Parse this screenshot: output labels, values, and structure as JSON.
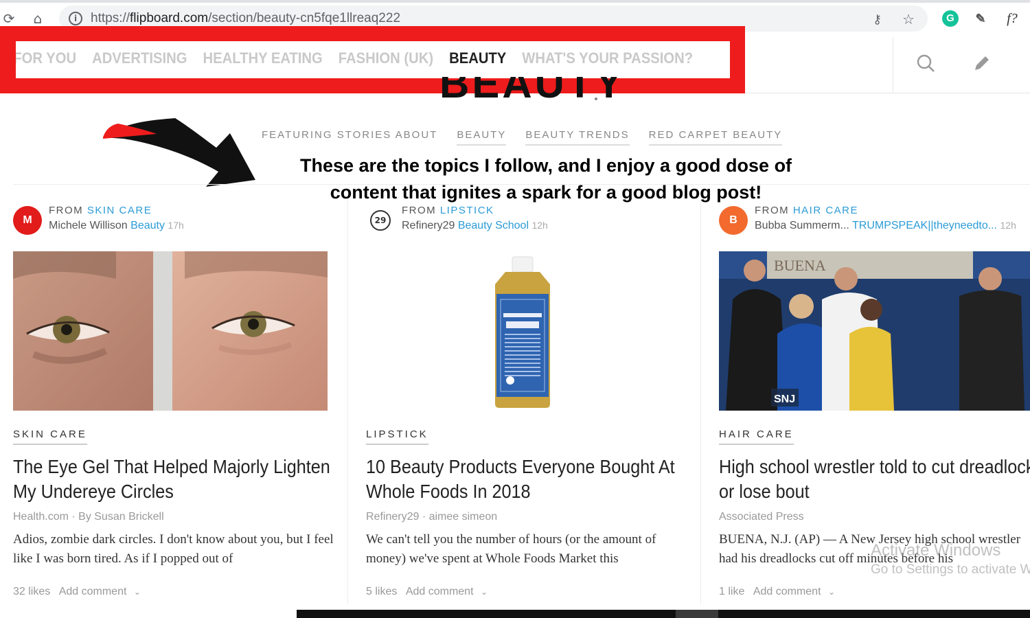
{
  "browser": {
    "url_host": "flipboard.com",
    "url_prefix": "https://",
    "url_path": "/section/beauty-cn5fqe1llreaq222",
    "icons": [
      "reload-icon",
      "home-icon",
      "info-icon",
      "key-icon",
      "star-icon",
      "grammarly-icon",
      "eyedropper-icon",
      "fx-icon"
    ],
    "ext_label": "f?"
  },
  "nav": {
    "tabs": [
      {
        "label": "FOR YOU",
        "active": false
      },
      {
        "label": "ADVERTISING",
        "active": false
      },
      {
        "label": "HEALTHY EATING",
        "active": false
      },
      {
        "label": "FASHION (UK)",
        "active": false
      },
      {
        "label": "BEAUTY",
        "active": true
      },
      {
        "label": "WHAT'S YOUR PASSION?",
        "active": false
      }
    ],
    "icons": [
      "search-icon",
      "pencil-icon"
    ]
  },
  "header": {
    "title": "BEAUTY",
    "featuring_label": "FEATURING STORIES ABOUT",
    "tags": [
      "BEAUTY",
      "BEAUTY TRENDS",
      "RED CARPET BEAUTY"
    ]
  },
  "annotation": {
    "text": "These are the topics I follow, and I enjoy a good dose of content that ignites a spark for a good blog post!"
  },
  "cards": [
    {
      "avatar": "M",
      "avatar_color": "#e21b1b",
      "from_label": "FROM",
      "from_magazine": "SKIN CARE",
      "author": "Michele Willison",
      "magazine": "Beauty",
      "time": "17h",
      "category": "SKIN CARE",
      "headline": "The Eye Gel That Helped Majorly Lighten My Undereye Circles",
      "source": "Health.com · By Susan Brickell",
      "excerpt": "Adios, zombie dark circles. I don't know about you, but I feel like I was born tired. As if I popped out of",
      "likes": "32 likes",
      "comment": "Add comment"
    },
    {
      "avatar": "29",
      "avatar_color": "#ffffff",
      "from_label": "FROM",
      "from_magazine": "LIPSTICK",
      "author": "Refinery29",
      "magazine": "Beauty School",
      "time": "12h",
      "category": "LIPSTICK",
      "headline": "10 Beauty Products Everyone Bought At Whole Foods In 2018",
      "source": "Refinery29 · aimee simeon",
      "excerpt": "We can't tell you the number of hours (or the amount of money) we've spent at Whole Foods Market this",
      "likes": "5 likes",
      "comment": "Add comment"
    },
    {
      "avatar": "B",
      "avatar_color": "#f26a2e",
      "from_label": "FROM",
      "from_magazine": "HAIR CARE",
      "author": "Bubba Summerm...",
      "magazine": "TRUMPSPEAK||theyneedto...",
      "time": "12h",
      "category": "HAIR CARE",
      "headline": "High school wrestler told to cut dreadlocks or lose bout",
      "source": "Associated Press",
      "excerpt": "BUENA, N.J. (AP) — A New Jersey high school wrestler had his dreadlocks cut off minutes before his",
      "likes": "1 like",
      "comment": "Add comment"
    }
  ],
  "images": {
    "card_photo_text": "BUENA",
    "snj_logo": "SNJ"
  },
  "watermark": {
    "line1": "Activate Windows",
    "line2": "Go to Settings to activate Windows."
  },
  "colors": {
    "accent": "#2b9bd6",
    "highlight_frame": "#ee1c1c"
  }
}
